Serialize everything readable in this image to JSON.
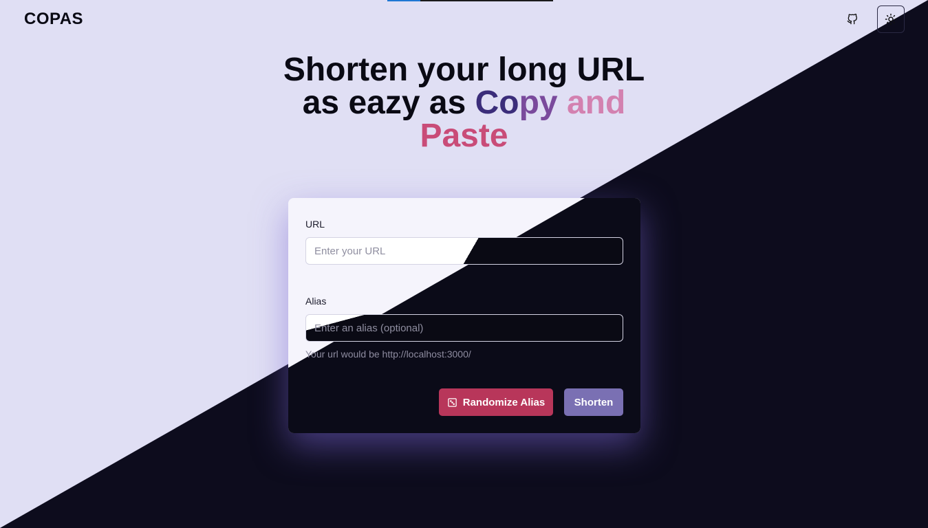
{
  "app": {
    "logo": "COPAS",
    "loading_progress": 0.2
  },
  "header": {
    "icons": [
      "github-icon",
      "sun-icon"
    ]
  },
  "hero": {
    "line1": "Shorten your long URL",
    "line2_plain": "as eazy as ",
    "line2_c1": "Co",
    "line2_c2": "py ",
    "line2_c3": "and",
    "line3": "Paste"
  },
  "form": {
    "url_label": "URL",
    "url_placeholder": "Enter your URL",
    "alias_label": "Alias",
    "alias_placeholder": "Enter an alias (optional)",
    "helper_text": "Your url would be http://localhost:3000/",
    "randomize_label": "Randomize Alias",
    "shorten_label": "Shorten"
  },
  "colors": {
    "light_bg": "#e0dff4",
    "dark_bg": "#0d0c1d",
    "primary_red": "#b8365a",
    "primary_purple": "#7a70b3"
  }
}
